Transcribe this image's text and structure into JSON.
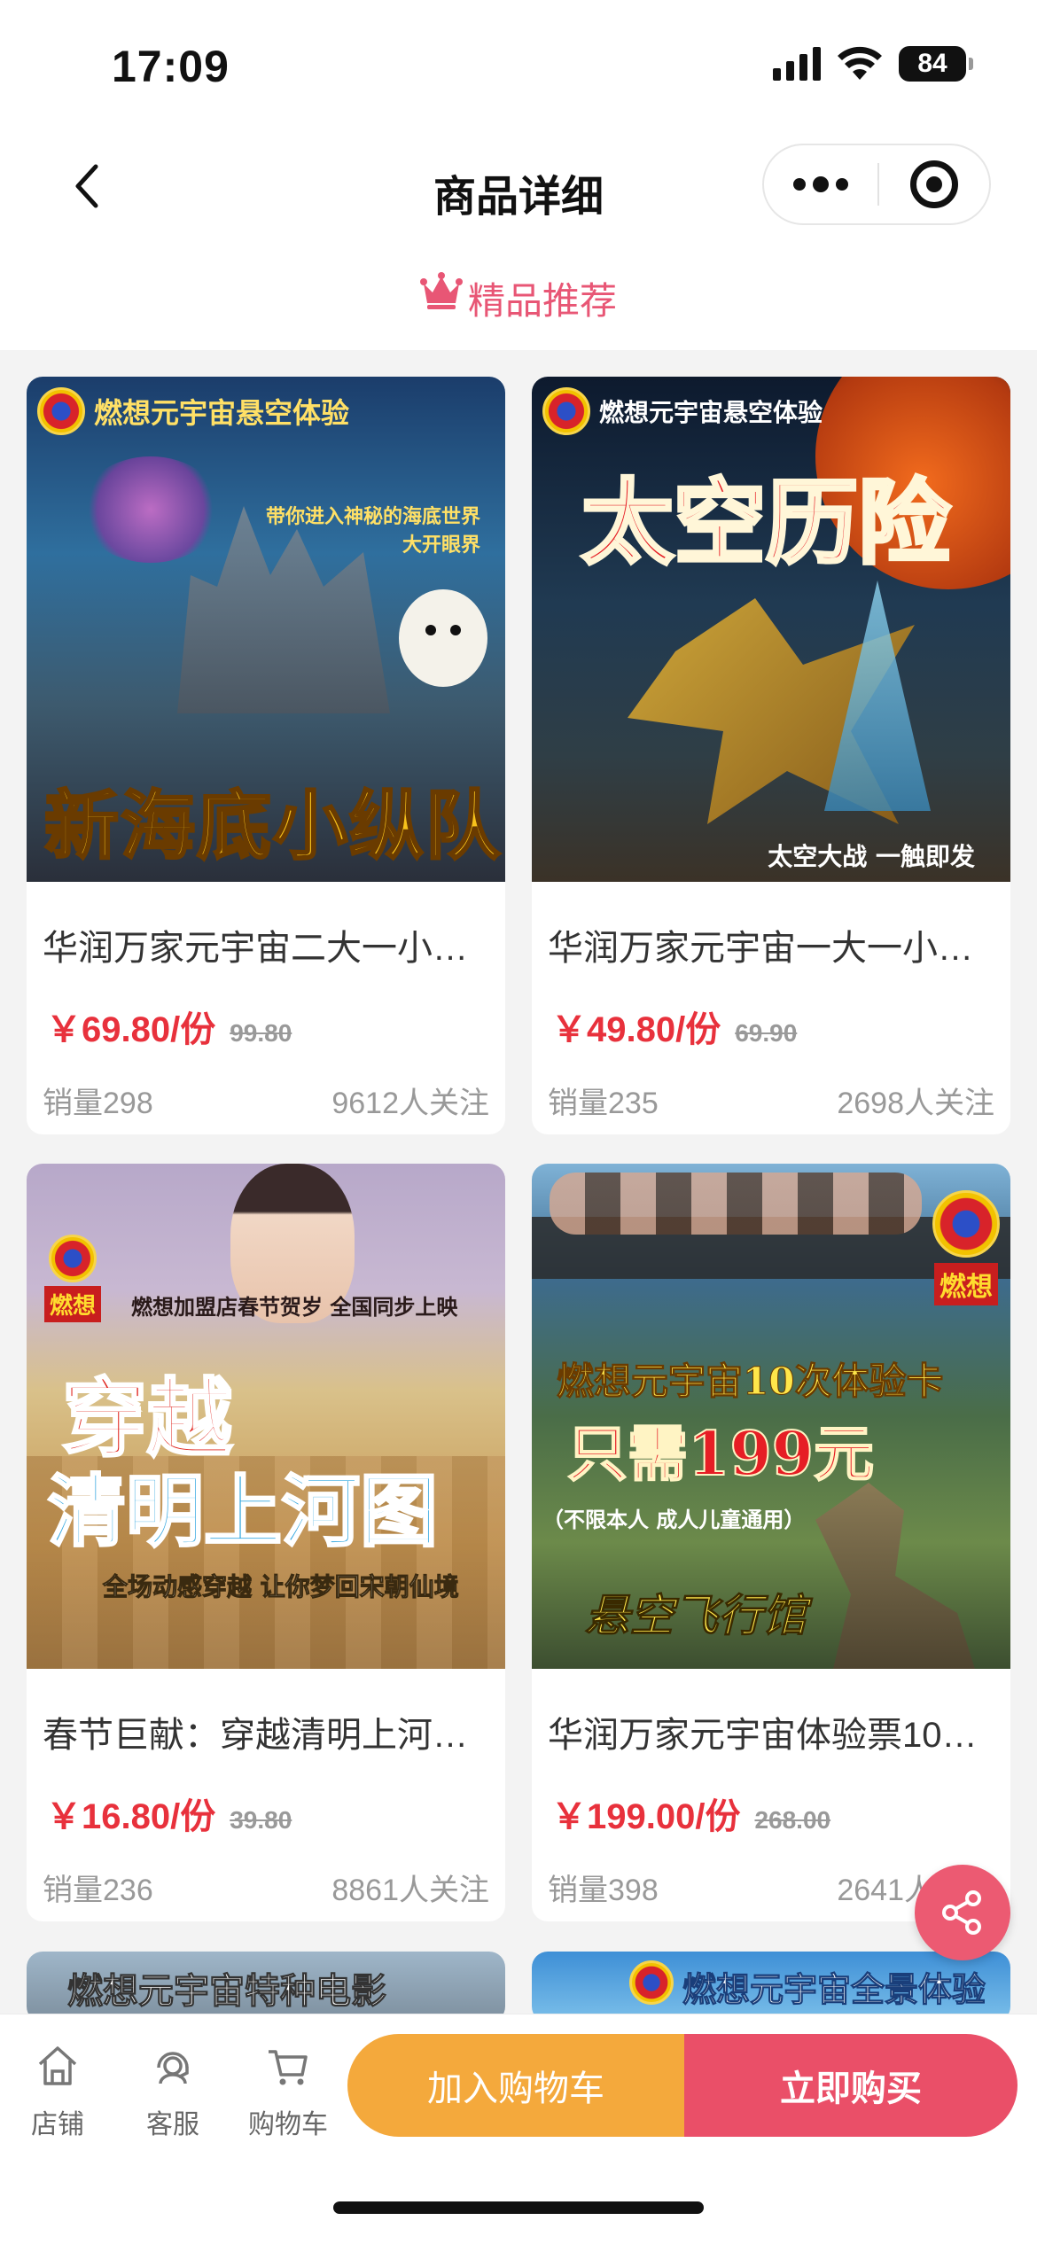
{
  "status_bar": {
    "time": "17:09",
    "battery": "84"
  },
  "nav": {
    "title": "商品详细"
  },
  "section": {
    "title": "精品推荐"
  },
  "products": [
    {
      "image": {
        "brand": "燃想元宇宙悬空体验",
        "headline": "新海底小纵队",
        "tagline_1": "带你进入神秘的海底世界",
        "tagline_2": "大开眼界"
      },
      "name": "华润万家元宇宙二大一小…",
      "price": "￥69.80/份",
      "original_price": "99.80",
      "sales": "销量298",
      "followers": "9612人关注"
    },
    {
      "image": {
        "brand": "燃想元宇宙悬空体验",
        "headline": "太空历险",
        "tagline_1": "太空大战 一触即发"
      },
      "name": "华润万家元宇宙一大一小…",
      "price": "￥49.80/份",
      "original_price": "69.90",
      "sales": "销量235",
      "followers": "2698人关注"
    },
    {
      "image": {
        "brand": "燃想",
        "subtitle": "燃想加盟店春节贺岁 全国同步上映",
        "headline_1": "穿越",
        "headline_2": "清明上河图",
        "tagline_1": "全场动感穿越 让你梦回宋朝仙境"
      },
      "name": "春节巨献：穿越清明上河…",
      "price": "￥16.80/份",
      "original_price": "39.80",
      "sales": "销量236",
      "followers": "8861人关注"
    },
    {
      "image": {
        "brand": "燃想",
        "headline_1": "燃想元宇宙10次体验卡",
        "headline_2": "只需199元",
        "tagline_1": "（不限本人 成人儿童通用）",
        "tagline_2": "悬空飞行馆"
      },
      "name": "华润万家元宇宙体验票10…",
      "price": "￥199.00/份",
      "original_price": "268.00",
      "sales": "销量398",
      "followers": "2641人关注"
    }
  ],
  "partial_cards": [
    {
      "headline": "燃想元宇宙特种电影"
    },
    {
      "headline": "燃想元宇宙全景体验"
    }
  ],
  "bottom_bar": {
    "tabs": [
      {
        "label": "店铺",
        "icon": "home-icon"
      },
      {
        "label": "客服",
        "icon": "headset-icon"
      },
      {
        "label": "购物车",
        "icon": "cart-icon"
      }
    ],
    "add_to_cart": "加入购物车",
    "buy_now": "立即购买"
  },
  "colors": {
    "accent_pink": "#e85675",
    "price_red": "#e8313c",
    "cart_orange": "#f4a93c",
    "buy_red": "#ea4f68"
  }
}
